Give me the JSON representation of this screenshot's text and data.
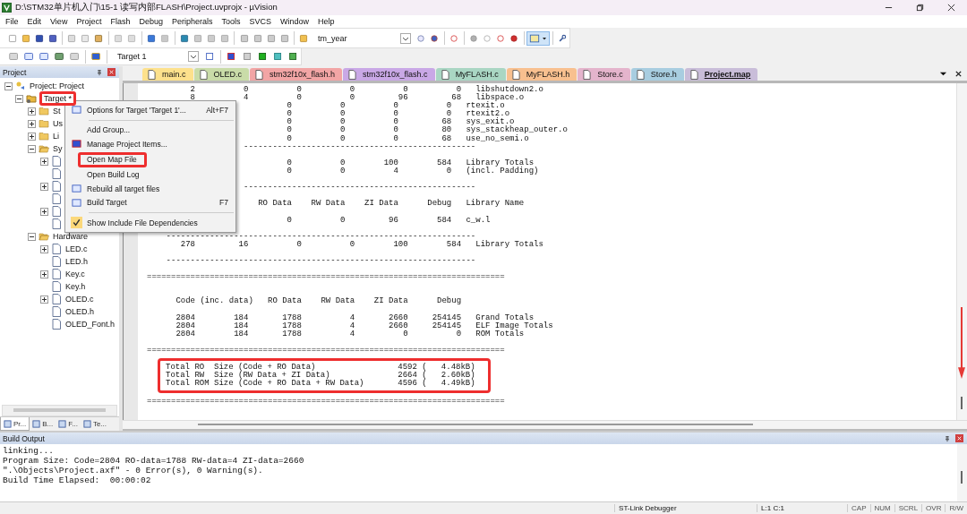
{
  "window": {
    "title": "D:\\STM32单片机入门\\15-1 读写内部FLASH\\Project.uvprojx - µVision"
  },
  "menu": [
    "File",
    "Edit",
    "View",
    "Project",
    "Flash",
    "Debug",
    "Peripherals",
    "Tools",
    "SVCS",
    "Window",
    "Help"
  ],
  "toolbar": {
    "find_value": "tm_year",
    "target": "Target 1"
  },
  "project_panel": {
    "title": "Project",
    "tree": {
      "label": "Project: Project",
      "expanded": true,
      "children": [
        {
          "label": "Target *",
          "highlighted": true,
          "expanded": true,
          "children": [
            {
              "label": "St",
              "expanded": false
            },
            {
              "label": "Us",
              "expanded": false
            },
            {
              "label": "Li",
              "expanded": false
            },
            {
              "label": "Sy",
              "expanded": true,
              "children": [
                {
                  "expandable": true
                },
                {
                  "expandable": false
                },
                {
                  "expandable": true
                },
                {
                  "expandable": false
                },
                {
                  "expandable": true
                },
                {
                  "expandable": false
                }
              ]
            },
            {
              "label": "Hardware",
              "expanded": true,
              "children": [
                {
                  "label": "LED.c",
                  "expandable": true
                },
                {
                  "label": "LED.h",
                  "expandable": false
                },
                {
                  "label": "Key.c",
                  "expandable": true
                },
                {
                  "label": "Key.h",
                  "expandable": false
                },
                {
                  "label": "OLED.c",
                  "expandable": true
                },
                {
                  "label": "OLED.h",
                  "expandable": false
                },
                {
                  "label": "OLED_Font.h",
                  "expandable": false
                }
              ]
            }
          ]
        }
      ]
    },
    "bottom_tabs": [
      {
        "label": "Pr...",
        "selected": true
      },
      {
        "label": "B...",
        "selected": false
      },
      {
        "label": "F...",
        "selected": false
      },
      {
        "label": "Te...",
        "selected": false
      }
    ]
  },
  "context_menu": [
    {
      "kind": "item",
      "label": "Options for Target 'Target 1'...",
      "shortcut": "Alt+F7",
      "highlighted": false,
      "checked": false
    },
    {
      "kind": "separator"
    },
    {
      "kind": "item",
      "label": "Add Group...",
      "highlighted": false,
      "checked": false
    },
    {
      "kind": "item",
      "label": "Manage Project Items...",
      "highlighted": false,
      "checked": false
    },
    {
      "kind": "item",
      "label": "Open Map File",
      "highlighted": true,
      "checked": false
    },
    {
      "kind": "item",
      "label": "Open Build Log",
      "highlighted": false,
      "checked": false
    },
    {
      "kind": "item",
      "label": "Rebuild all target files",
      "highlighted": false,
      "checked": false
    },
    {
      "kind": "item",
      "label": "Build Target",
      "shortcut": "F7",
      "highlighted": false,
      "checked": false
    },
    {
      "kind": "separator"
    },
    {
      "kind": "item",
      "label": "Show Include File Dependencies",
      "highlighted": false,
      "checked": true
    }
  ],
  "tabs": [
    {
      "label": "main.c",
      "color": "#fde18c",
      "selected": false
    },
    {
      "label": "OLED.c",
      "color": "#c9dca8",
      "selected": false
    },
    {
      "label": "stm32f10x_flash.h",
      "color": "#f2a5a5",
      "selected": false
    },
    {
      "label": "stm32f10x_flash.c",
      "color": "#c9a8e6",
      "selected": false
    },
    {
      "label": "MyFLASH.c",
      "color": "#a9d6c3",
      "selected": false
    },
    {
      "label": "MyFLASH.h",
      "color": "#f8c08f",
      "selected": false
    },
    {
      "label": "Store.c",
      "color": "#e4b4cc",
      "selected": false
    },
    {
      "label": "Store.h",
      "color": "#a8cde0",
      "selected": false
    },
    {
      "label": "Project.map",
      "color": "#c9bdd9",
      "selected": true
    }
  ],
  "editor": {
    "blocks": [
      {
        "highlighted": false,
        "lines": [
          {
            "kind": "text",
            "text": "         2          0          0          0          0          0   libshutdown2.o"
          },
          {
            "kind": "text",
            "text": "         8          4          0          0         96         68   libspace.o"
          },
          {
            "kind": "text",
            "covered": true,
            "text": "         0          0          0          0   rtexit.o"
          },
          {
            "kind": "text",
            "covered": true,
            "text": "         0          0          0          0   rtexit2.o"
          },
          {
            "kind": "text",
            "covered": true,
            "text": "         0          0          0         68   sys_exit.o"
          },
          {
            "kind": "text",
            "covered": true,
            "text": "         0          0          0         80   sys_stackheap_outer.o"
          },
          {
            "kind": "text",
            "covered": true,
            "text": "         0          0          0         68   use_no_semi.o"
          },
          {
            "kind": "text",
            "covered": true,
            "text": "------------------------------------------------"
          },
          {
            "kind": "blank"
          },
          {
            "kind": "text",
            "covered": true,
            "text": "         0          0        100        584   Library Totals"
          },
          {
            "kind": "text",
            "covered": true,
            "text": "         0          0          4          0   (incl. Padding)"
          },
          {
            "kind": "blank"
          },
          {
            "kind": "text",
            "covered": true,
            "text": "------------------------------------------------"
          },
          {
            "kind": "blank"
          },
          {
            "kind": "text",
            "covered": true,
            "text": "   RO Data    RW Data    ZI Data      Debug   Library Name"
          },
          {
            "kind": "blank"
          },
          {
            "kind": "text",
            "covered": true,
            "text": "         0          0         96        584   c_w.l"
          },
          {
            "kind": "blank"
          },
          {
            "kind": "text",
            "text": "    ----------------------------------------------------------------"
          },
          {
            "kind": "text",
            "text": "       278         16          0          0        100        584   Library Totals"
          },
          {
            "kind": "blank"
          },
          {
            "kind": "text",
            "text": "    ----------------------------------------------------------------"
          },
          {
            "kind": "blank"
          },
          {
            "kind": "text",
            "text": "=========================================================================="
          },
          {
            "kind": "blank"
          },
          {
            "kind": "blank"
          },
          {
            "kind": "text",
            "text": "      Code (inc. data)   RO Data    RW Data    ZI Data      Debug"
          },
          {
            "kind": "blank"
          },
          {
            "kind": "text",
            "text": "      2804        184       1788          4       2660     254145   Grand Totals"
          },
          {
            "kind": "text",
            "text": "      2804        184       1788          4       2660     254145   ELF Image Totals"
          },
          {
            "kind": "text",
            "text": "      2804        184       1788          4          0          0   ROM Totals"
          },
          {
            "kind": "blank"
          },
          {
            "kind": "text",
            "text": "=========================================================================="
          }
        ]
      },
      {
        "highlighted": true,
        "lines": [
          {
            "kind": "text",
            "text": "Total RO  Size (Code + RO Data)                 4592 (   4.48kB)"
          },
          {
            "kind": "text",
            "text": "Total RW  Size (RW Data + ZI Data)              2664 (   2.60kB)"
          },
          {
            "kind": "text",
            "text": "Total ROM Size (Code + RO Data + RW Data)       4596 (   4.49kB)"
          }
        ]
      },
      {
        "highlighted": false,
        "lines": [
          {
            "kind": "text",
            "text": "=========================================================================="
          }
        ]
      }
    ]
  },
  "build_output": {
    "title": "Build Output",
    "lines": [
      "linking...",
      "Program Size: Code=2804 RO-data=1788 RW-data=4 ZI-data=2660",
      "\".\\Objects\\Project.axf\" - 0 Error(s), 0 Warning(s).",
      "Build Time Elapsed:  00:00:02"
    ]
  },
  "status_bar": {
    "debugger": "ST-Link Debugger",
    "position": "L:1 C:1",
    "indicators": [
      "CAP",
      "NUM",
      "SCRL",
      "OVR",
      "R/W"
    ]
  }
}
